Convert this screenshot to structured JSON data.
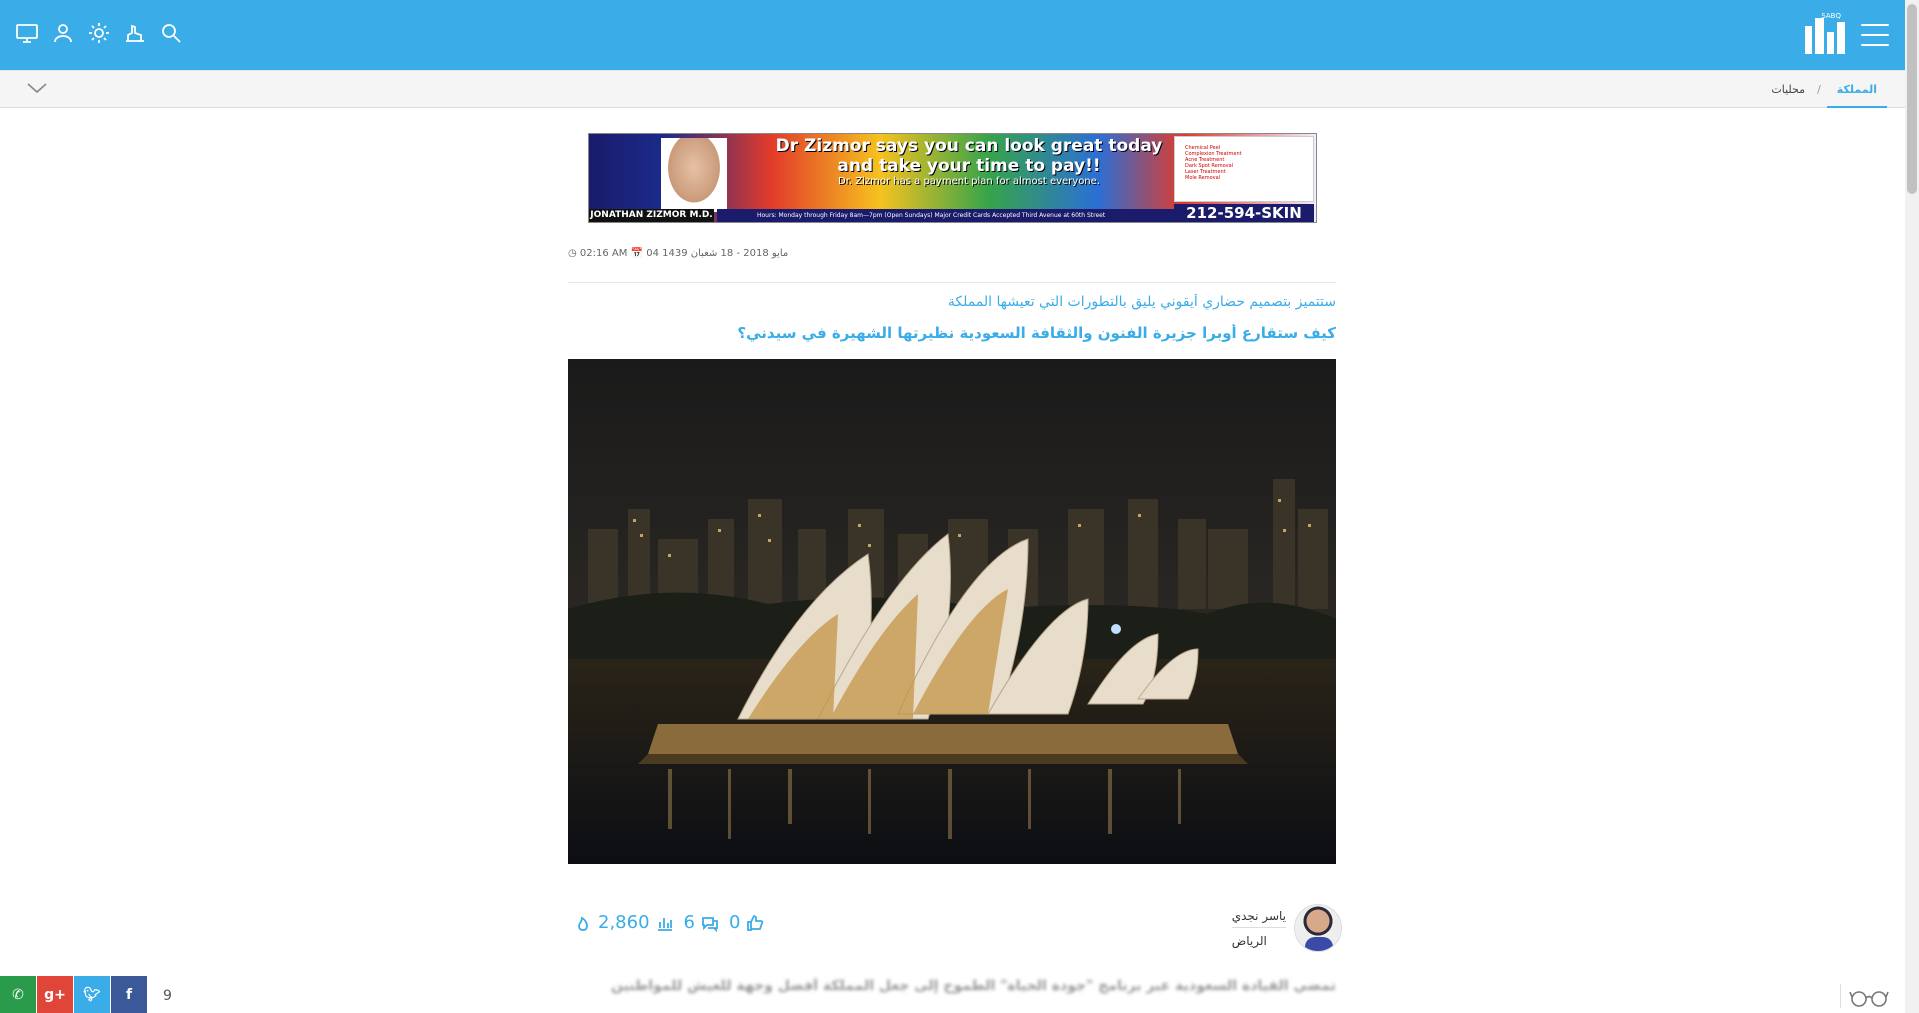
{
  "header": {
    "brand_text": "SABQ",
    "icons": [
      "desktop-icon",
      "user-icon",
      "brightness-icon",
      "sign-language-icon",
      "search-icon"
    ],
    "menu_icon": "hamburger-icon"
  },
  "subnav": {
    "active": "المملكة",
    "separator": "/",
    "crumb": "محليات"
  },
  "ad": {
    "line1": "Dr Zizmor says you can look great today",
    "line2": "and take your time to pay!!",
    "line3": "Dr. Zizmor has a payment plan for almost everyone.",
    "name": "JONATHAN ZIZMOR M.D.",
    "hours": "Hours: Monday through Friday 8am—7pm (Open Sundays)   Major Credit Cards Accepted   Third Avenue at 60th Street",
    "phone": "212-594-SKIN",
    "treatments": [
      "Chemical Peel",
      "Complexion Treatment",
      "Acne Treatment",
      "Dark Spot Removal",
      "Laser Treatment",
      "Mole Removal"
    ]
  },
  "article": {
    "date": "04 مايو 2018 - 18 شعبان 1439",
    "time": "02:16 AM",
    "subtitle": "ستتميز بتصميم حضاري أيقوني يليق بالتطورات التي تعيشها المملكة",
    "title": "كيف ستقارع أوبرا جزيرة الفنون والثقافة السعودية نظيرتها الشهيرة في سيدني؟",
    "teaser": "تمضي القيادة السعودية عبر برنامج \"جودة الحياة\" الطموح إلى جعل المملكة أفضل وجهة للعيش للمواطنين"
  },
  "author": {
    "name": "ياسر نجدي",
    "city": "الرياض"
  },
  "stats": {
    "likes": "0",
    "comments": "6",
    "views": "2,860"
  },
  "share": {
    "count": "9",
    "buttons": [
      "whatsapp-icon",
      "google-plus-icon",
      "twitter-icon",
      "facebook-icon"
    ]
  },
  "colors": {
    "brand": "#3aace8",
    "whatsapp": "#2a9b4a",
    "google_plus": "#e0453a",
    "twitter": "#3aace8",
    "facebook": "#3b5998"
  }
}
